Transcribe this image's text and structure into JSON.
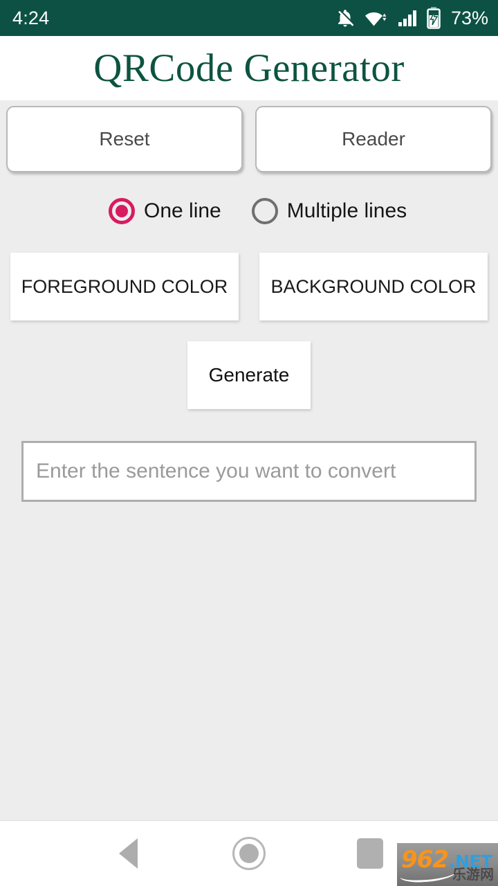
{
  "status_bar": {
    "time": "4:24",
    "battery_percent": "73%",
    "icons": [
      "notifications-off-icon",
      "wifi-icon",
      "cellular-signal-icon",
      "battery-charging-icon"
    ],
    "background_color": "#0d5144",
    "text_color": "#ffffff"
  },
  "header": {
    "title": "QRCode Generator",
    "title_color": "#0d5440",
    "background_color": "#ffffff"
  },
  "content": {
    "background_color": "#ededed",
    "top_buttons": {
      "reset_label": "Reset",
      "reader_label": "Reader"
    },
    "line_mode": {
      "selected": "One line",
      "accent_color": "#d81b60",
      "options": [
        {
          "label": "One line",
          "checked": true
        },
        {
          "label": "Multiple lines",
          "checked": false
        }
      ]
    },
    "color_buttons": {
      "foreground_label": "FOREGROUND COLOR",
      "background_label": "BACKGROUND COLOR"
    },
    "generate_label": "Generate",
    "input": {
      "value": "",
      "placeholder": "Enter the sentence you want to convert"
    }
  },
  "nav_bar": {
    "back_label": "Back",
    "home_label": "Home",
    "recents_label": "Recents",
    "icon_color": "#b0b0b0"
  },
  "watermark": {
    "number": "962",
    "domain": ".NET",
    "chinese": "乐游网"
  }
}
